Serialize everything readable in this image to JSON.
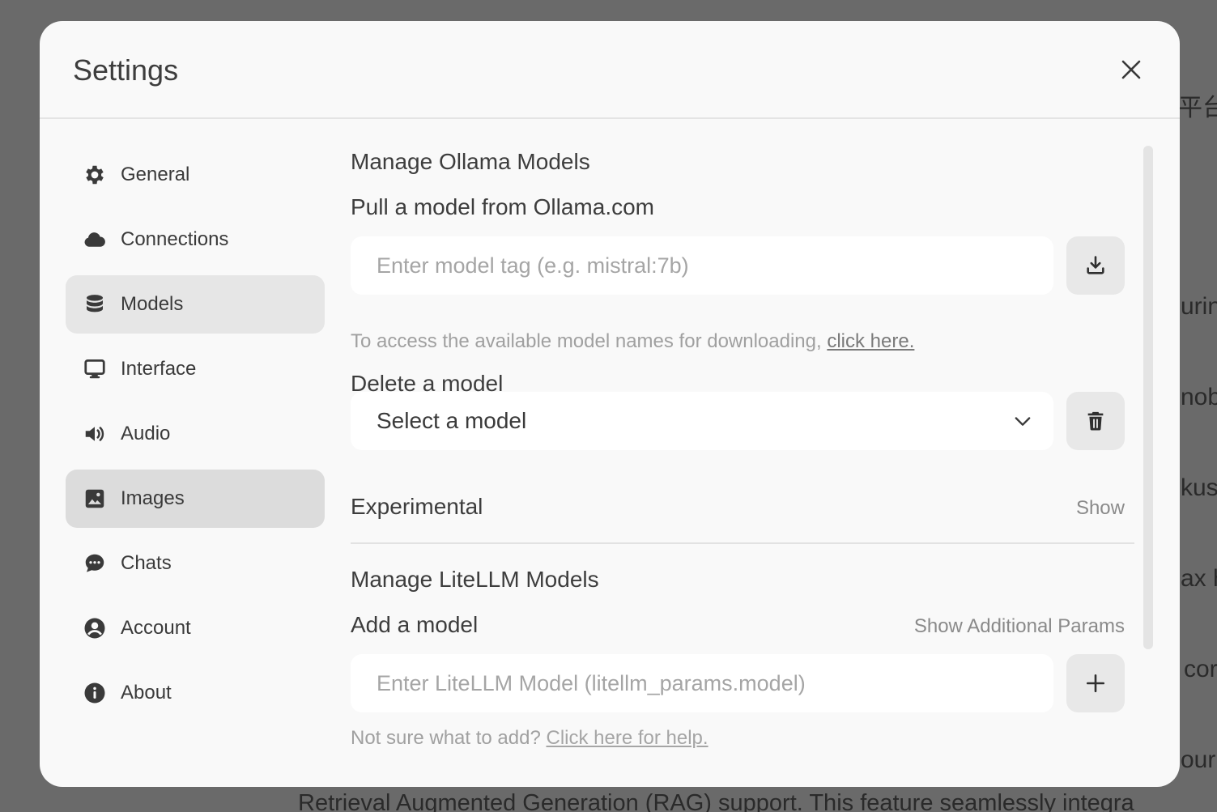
{
  "background": {
    "fragments": [
      "平台",
      "urin",
      "nobi",
      "kus",
      "ax h",
      "cor",
      "our"
    ],
    "bottom_text": "Retrieval Augmented Generation (RAG) support. This feature seamlessly integra"
  },
  "modal": {
    "title": "Settings"
  },
  "sidebar": {
    "items": [
      {
        "label": "General",
        "icon": "gear-icon"
      },
      {
        "label": "Connections",
        "icon": "cloud-icon"
      },
      {
        "label": "Models",
        "icon": "database-icon"
      },
      {
        "label": "Interface",
        "icon": "monitor-icon"
      },
      {
        "label": "Audio",
        "icon": "speaker-icon"
      },
      {
        "label": "Images",
        "icon": "image-icon"
      },
      {
        "label": "Chats",
        "icon": "chat-bubble-icon"
      },
      {
        "label": "Account",
        "icon": "user-circle-icon"
      },
      {
        "label": "About",
        "icon": "info-icon"
      }
    ],
    "active": "Models",
    "hovered": "Images"
  },
  "ollama": {
    "section_title": "Manage Ollama Models",
    "pull_title": "Pull a model from Ollama.com",
    "pull_placeholder": "Enter model tag (e.g. mistral:7b)",
    "pull_hint": "To access the available model names for downloading,",
    "pull_hint_link": "click here.",
    "delete_title": "Delete a model",
    "delete_select_value": "Select a model",
    "experimental_label": "Experimental",
    "experimental_toggle": "Show"
  },
  "litellm": {
    "section_title": "Manage LiteLLM Models",
    "add_title": "Add a model",
    "additional_params_toggle": "Show Additional Params",
    "add_placeholder": "Enter LiteLLM Model (litellm_params.model)",
    "add_hint": "Not sure what to add?",
    "add_hint_link": "Click here for help."
  }
}
